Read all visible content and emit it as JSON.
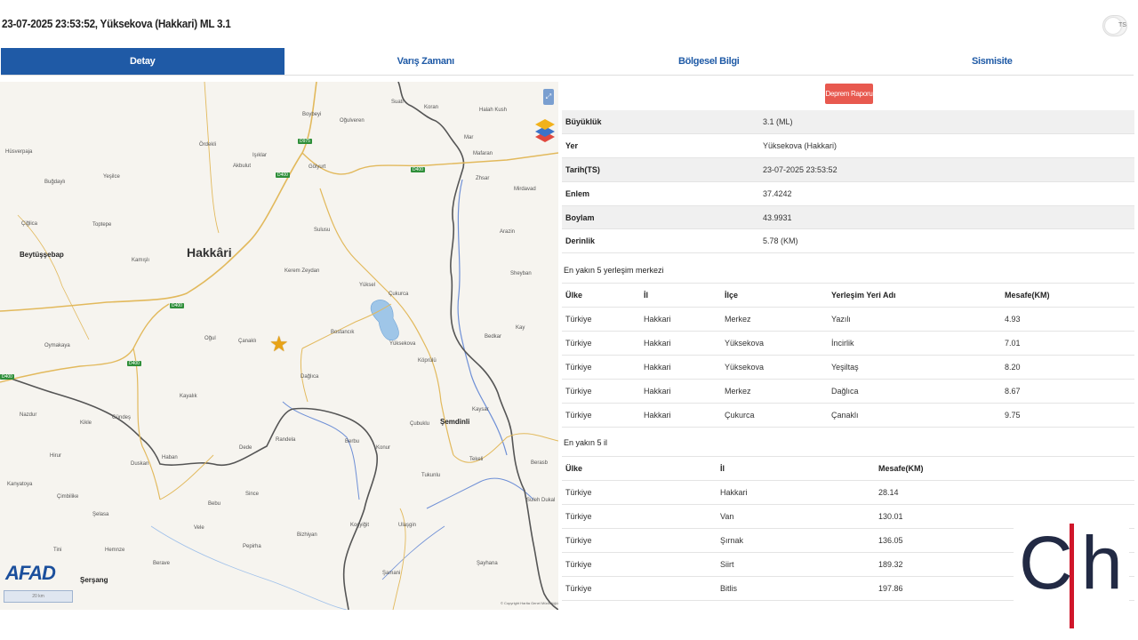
{
  "header": {
    "title": "23-07-2025 23:53:52, Yüksekova (Hakkari) ML 3.1",
    "toggle_label": "TS"
  },
  "tabs": [
    {
      "label": "Detay",
      "active": true
    },
    {
      "label": "Varış Zamanı",
      "active": false
    },
    {
      "label": "Bölgesel Bilgi",
      "active": false
    },
    {
      "label": "Sismisite",
      "active": false
    }
  ],
  "map": {
    "labels": {
      "hakkari": "Hakkâri",
      "beytussebap": "Beytüşşebap",
      "semdinli": "Şemdinli",
      "sersang": "Şerşang",
      "yuksekova_town": "Yüksekova",
      "hosverpaja": "Hüsverpaja",
      "bugdayli": "Buğdaylı",
      "yesilce": "Yeşilce",
      "ciglica": "Çiğlica",
      "topkaya": "Toptepe",
      "kamisli": "Kamışlı",
      "ormanli": "Örmanlı",
      "oymakaya": "Oymakaya",
      "ogul": "Oğul",
      "canakli": "Çanaklı",
      "kayalik": "Kayalık",
      "daglica": "Dağlıca",
      "bostancik": "Bostancık",
      "kerem_zeydan": "Kerem Zeydan",
      "sulusu": "Sulusu",
      "yuksel": "Yüksel",
      "cukurca": "Çukurca",
      "koprulu": "Köprülü",
      "golyurt": "Gölyurt",
      "akbulut": "Akbulut",
      "ordekli": "Ördekli",
      "isikli": "Işıklar",
      "ogulveren": "Oğulveren",
      "boybeyi": "Boybeyi",
      "suati": "Suati",
      "koran": "Koran",
      "halah_kush": "Halah Kush",
      "mar": "Mar",
      "mafaran": "Mafaran",
      "zhar": "Zhsar",
      "mirdavad": "Mirdavad",
      "arazin": "Arazin",
      "sheyban": "Sheyban",
      "bedkar": "Bedkar",
      "kay": "Kay",
      "kaysar": "Kaysar",
      "tekeli": "Tekeli",
      "berasb": "Berasb",
      "suleh_dukal": "Suleh Dukal",
      "sayhana": "Şayhana",
      "samani": "Şamani",
      "ulusgin": "Ulaşgin",
      "koygol": "Koçyiğit",
      "bizhiyan": "Bizhiyan",
      "peptha": "Pepirha",
      "vele": "Vele",
      "bebu": "Bebu",
      "since": "Since",
      "dede": "Dede",
      "randela": "Randela",
      "berbu": "Berbu",
      "konur": "Konur",
      "tukunlu": "Tukunlu",
      "cubuklu": "Çubuklu",
      "hirur": "Hirur",
      "kanyatoya": "Kanyatoya",
      "cimbilike": "Çimbilike",
      "selasa": "Şelasa",
      "hemnze": "Hemnze",
      "berave": "Berave",
      "duskan": "Duskan",
      "tini": "Tini",
      "nazdur": "Nazdur",
      "kikle": "Kikle",
      "gundes": "Gündeş",
      "haban": "Haban",
      "copyright": "© Copyright Harita Genel Müdürlüğü",
      "scale": "20 km"
    },
    "road_badges": [
      "D400",
      "D400",
      "D400",
      "D975",
      "D400",
      "D400"
    ],
    "afad_logo": "AFAD"
  },
  "report_button": "Deprem Raporu",
  "details": [
    {
      "key": "Büyüklük",
      "value": "3.1 (ML)"
    },
    {
      "key": "Yer",
      "value": "Yüksekova (Hakkari)"
    },
    {
      "key": "Tarih(TS)",
      "value": "23-07-2025 23:53:52"
    },
    {
      "key": "Enlem",
      "value": "37.4242"
    },
    {
      "key": "Boylam",
      "value": "43.9931"
    },
    {
      "key": "Derinlik",
      "value": "5.78 (KM)"
    }
  ],
  "settlements": {
    "title": "En yakın 5 yerleşim merkezi",
    "headers": [
      "Ülke",
      "İl",
      "İlçe",
      "Yerleşim Yeri Adı",
      "Mesafe(KM)"
    ],
    "rows": [
      [
        "Türkiye",
        "Hakkari",
        "Merkez",
        "Yazılı",
        "4.93"
      ],
      [
        "Türkiye",
        "Hakkari",
        "Yüksekova",
        "İncirlik",
        "7.01"
      ],
      [
        "Türkiye",
        "Hakkari",
        "Yüksekova",
        "Yeşiltaş",
        "8.20"
      ],
      [
        "Türkiye",
        "Hakkari",
        "Merkez",
        "Dağlıca",
        "8.67"
      ],
      [
        "Türkiye",
        "Hakkari",
        "Çukurca",
        "Çanaklı",
        "9.75"
      ]
    ]
  },
  "provinces": {
    "title": "En yakın 5 il",
    "headers": [
      "Ülke",
      "İl",
      "Mesafe(KM)"
    ],
    "rows": [
      [
        "Türkiye",
        "Hakkari",
        "28.14"
      ],
      [
        "Türkiye",
        "Van",
        "130.01"
      ],
      [
        "Türkiye",
        "Şırnak",
        "136.05"
      ],
      [
        "Türkiye",
        "Siirt",
        "189.32"
      ],
      [
        "Türkiye",
        "Bitlis",
        "197.86"
      ]
    ]
  },
  "watermark": {
    "left": "C",
    "right": "h"
  },
  "colors": {
    "accent": "#1f5aa6",
    "report": "#e8594f",
    "star": "#e8a317",
    "logo_red": "#d0162a",
    "logo_navy": "#222a44"
  }
}
